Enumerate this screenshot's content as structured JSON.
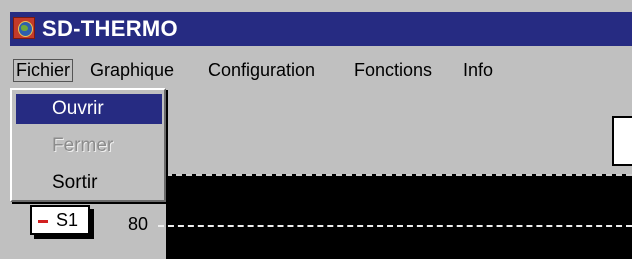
{
  "window": {
    "title": "SD-THERMO",
    "app_icon": "globe-icon"
  },
  "menubar": {
    "items": [
      {
        "label": "Fichier",
        "open": true
      },
      {
        "label": "Graphique"
      },
      {
        "label": "Configuration"
      },
      {
        "label": "Fonctions"
      },
      {
        "label": "Info"
      }
    ]
  },
  "dropdown": {
    "items": [
      {
        "label": "Ouvrir",
        "state": "selected"
      },
      {
        "label": "Fermer",
        "state": "disabled"
      },
      {
        "label": "Sortir",
        "state": "enabled"
      }
    ]
  },
  "chart": {
    "series_label": "S1",
    "series_color": "#d22020",
    "y_tick": "80",
    "background": "#000000"
  }
}
